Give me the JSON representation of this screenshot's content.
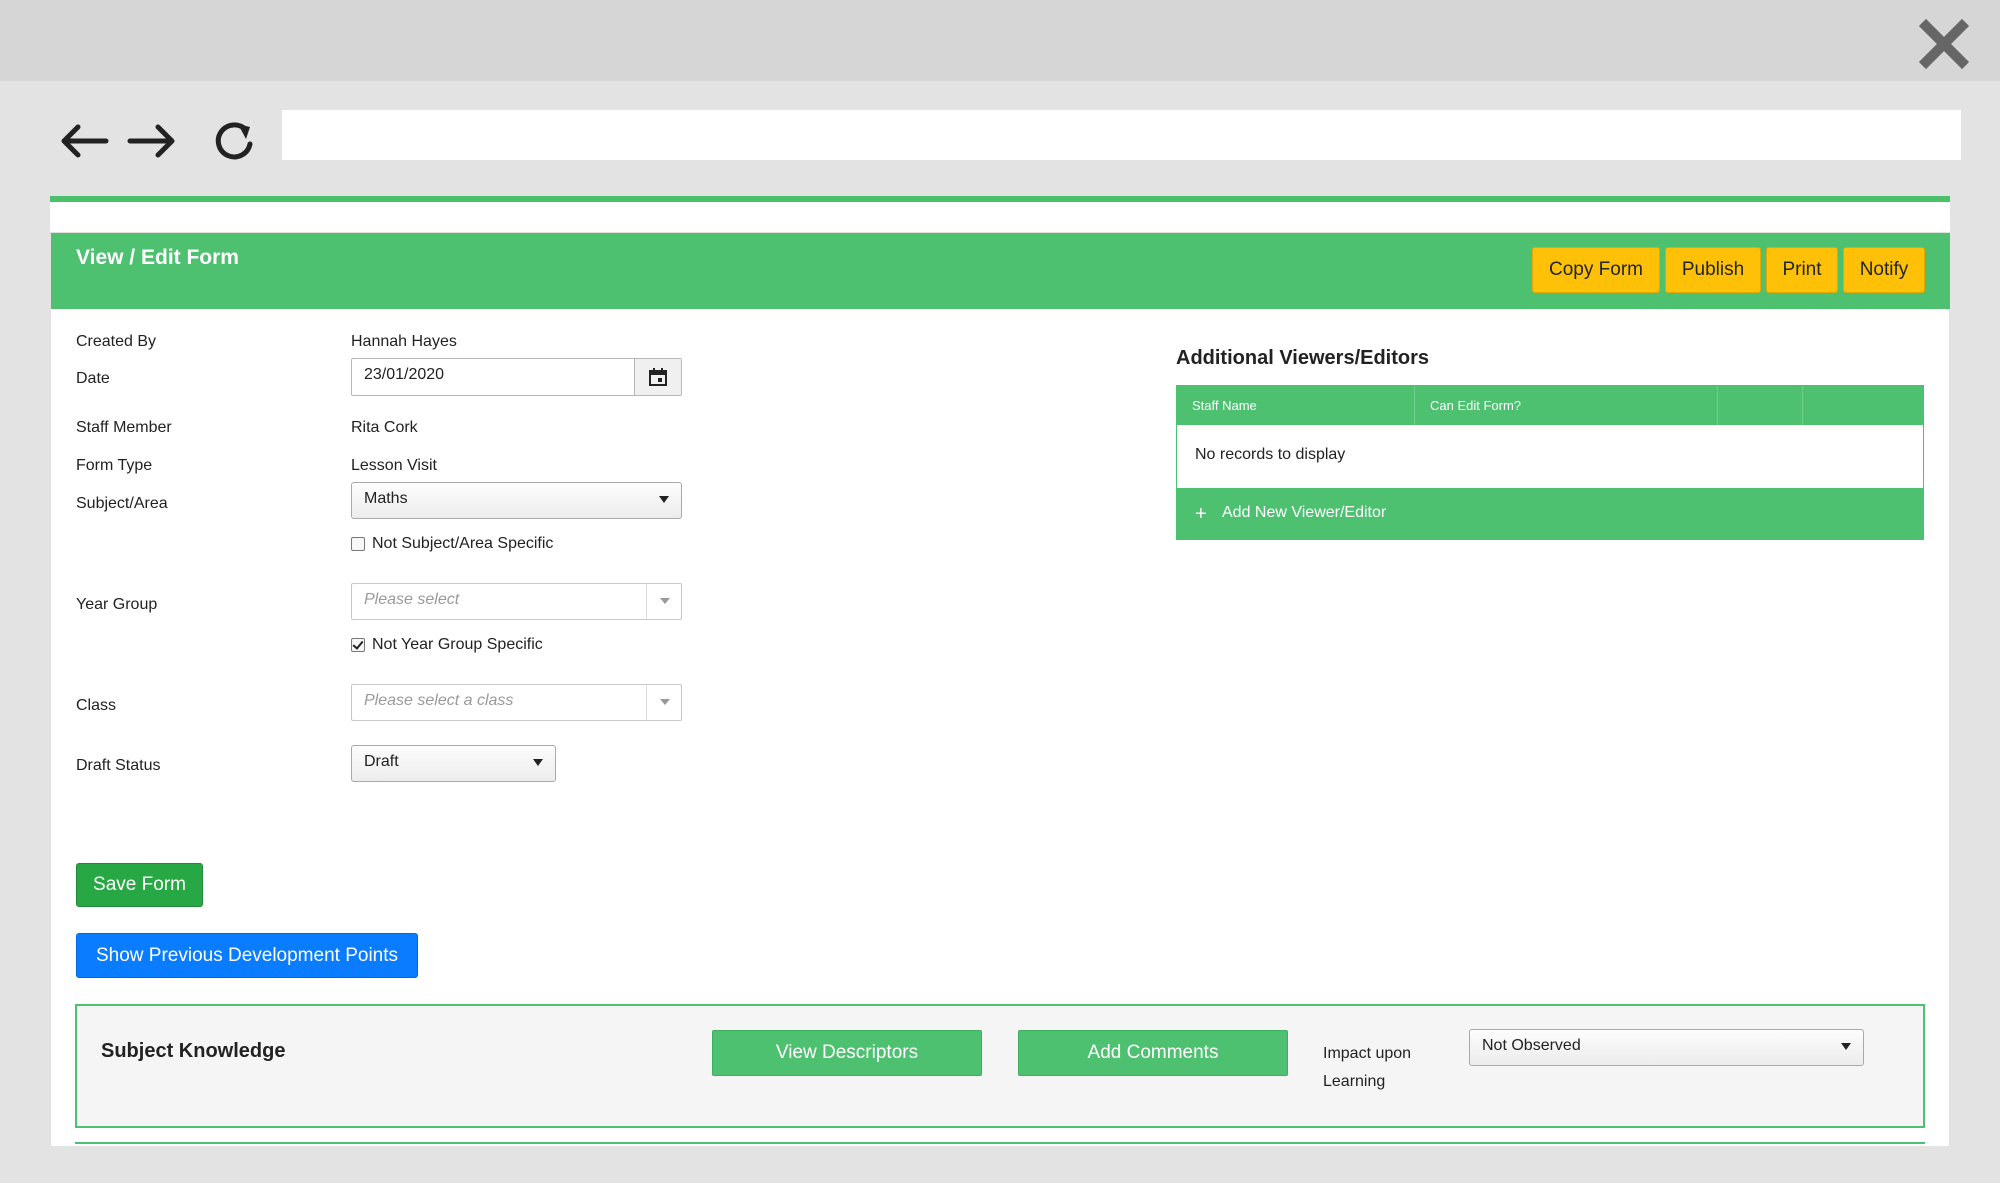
{
  "browser": {
    "url": "",
    "icons": [
      "back-arrow-icon",
      "forward-arrow-icon",
      "reload-icon",
      "close-icon"
    ]
  },
  "header": {
    "title": "View / Edit Form",
    "buttons": {
      "copy_form": "Copy Form",
      "publish": "Publish",
      "print": "Print",
      "notify": "Notify"
    }
  },
  "form": {
    "created_by": {
      "label": "Created By",
      "value": "Hannah Hayes"
    },
    "date": {
      "label": "Date",
      "value": "23/01/2020"
    },
    "staff_member": {
      "label": "Staff Member",
      "value": "Rita Cork"
    },
    "form_type": {
      "label": "Form Type",
      "value": "Lesson Visit"
    },
    "subject_area": {
      "label": "Subject/Area",
      "value": "Maths",
      "checkbox_label": "Not Subject/Area Specific",
      "checked": false
    },
    "year_group": {
      "label": "Year Group",
      "placeholder": "Please select",
      "checkbox_label": "Not Year Group Specific",
      "checked": true
    },
    "class": {
      "label": "Class",
      "placeholder": "Please select a class"
    },
    "draft_status": {
      "label": "Draft Status",
      "value": "Draft"
    },
    "save_label": "Save Form",
    "show_previous_label": "Show Previous Development Points"
  },
  "viewers": {
    "title": "Additional Viewers/Editors",
    "columns": [
      "Staff Name",
      "Can Edit Form?",
      "",
      ""
    ],
    "empty_text": "No records to display",
    "add_label": "Add New Viewer/Editor"
  },
  "subject_knowledge": {
    "title": "Subject Knowledge",
    "view_descriptors": "View Descriptors",
    "add_comments": "Add Comments",
    "impact_label": "Impact upon Learning",
    "impact_value": "Not Observed"
  },
  "colors": {
    "brand_green": "#4dc170",
    "save_green": "#27a844",
    "action_blue": "#0a7cff",
    "header_yellow": "#ffc107"
  }
}
